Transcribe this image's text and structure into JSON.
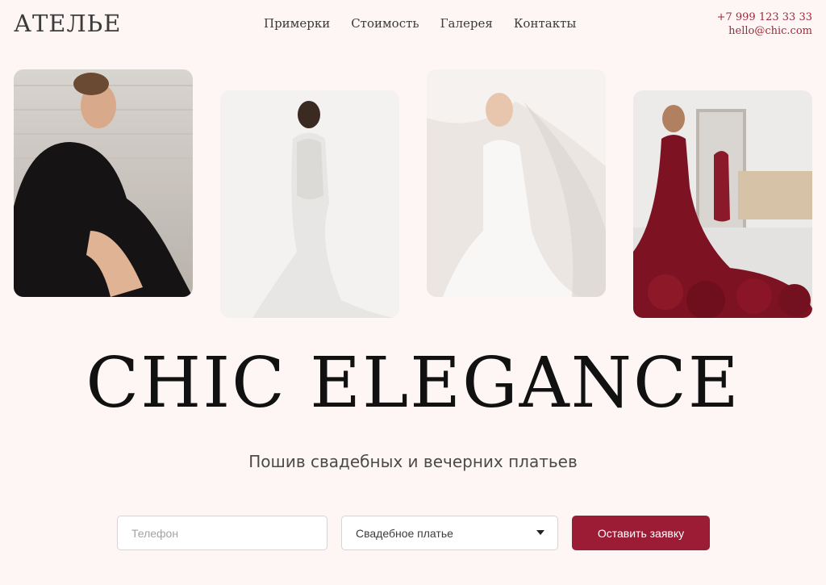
{
  "header": {
    "logo": "АТЕЛЬЕ",
    "nav": [
      "Примерки",
      "Стоимость",
      "Галерея",
      "Контакты"
    ],
    "phone": "+7 999 123 33 33",
    "email": "hello@chic.com"
  },
  "gallery": [
    {
      "icon": "photo-black-lace-dress"
    },
    {
      "icon": "photo-white-mermaid-gown"
    },
    {
      "icon": "photo-bride-veil"
    },
    {
      "icon": "photo-burgundy-ruffle-gown"
    }
  ],
  "hero": {
    "title": "CHIC ELEGANCE",
    "subtitle": "Пошив свадебных и вечерних платьев"
  },
  "form": {
    "phone_placeholder": "Телефон",
    "dress_type": "Свадебное платье",
    "submit_label": "Оставить заявку"
  },
  "colors": {
    "background": "#fdf6f5",
    "accent": "#9c1c36",
    "contact_text": "#9a2a3b"
  }
}
